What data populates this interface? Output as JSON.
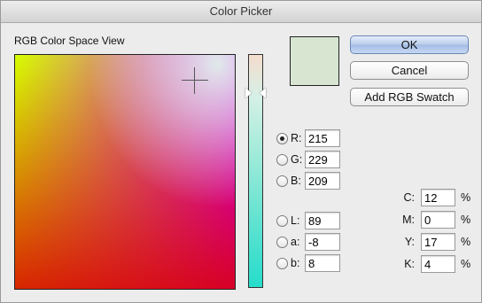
{
  "window": {
    "title": "Color Picker"
  },
  "view": {
    "label": "RGB Color Space View"
  },
  "current_color": {
    "hex": "#d7e5d1"
  },
  "buttons": {
    "ok": "OK",
    "cancel": "Cancel",
    "add_swatch": "Add RGB Swatch"
  },
  "rgb": {
    "r": {
      "label": "R:",
      "value": "215",
      "selected": true
    },
    "g": {
      "label": "G:",
      "value": "229",
      "selected": false
    },
    "b": {
      "label": "B:",
      "value": "209",
      "selected": false
    }
  },
  "lab": {
    "l": {
      "label": "L:",
      "value": "89",
      "selected": false
    },
    "a": {
      "label": "a:",
      "value": "-8",
      "selected": false
    },
    "b": {
      "label": "b:",
      "value": "8",
      "selected": false
    }
  },
  "cmyk": {
    "c": {
      "label": "C:",
      "value": "12"
    },
    "m": {
      "label": "M:",
      "value": "0"
    },
    "y": {
      "label": "Y:",
      "value": "17"
    },
    "k": {
      "label": "K:",
      "value": "4"
    },
    "unit": "%"
  }
}
